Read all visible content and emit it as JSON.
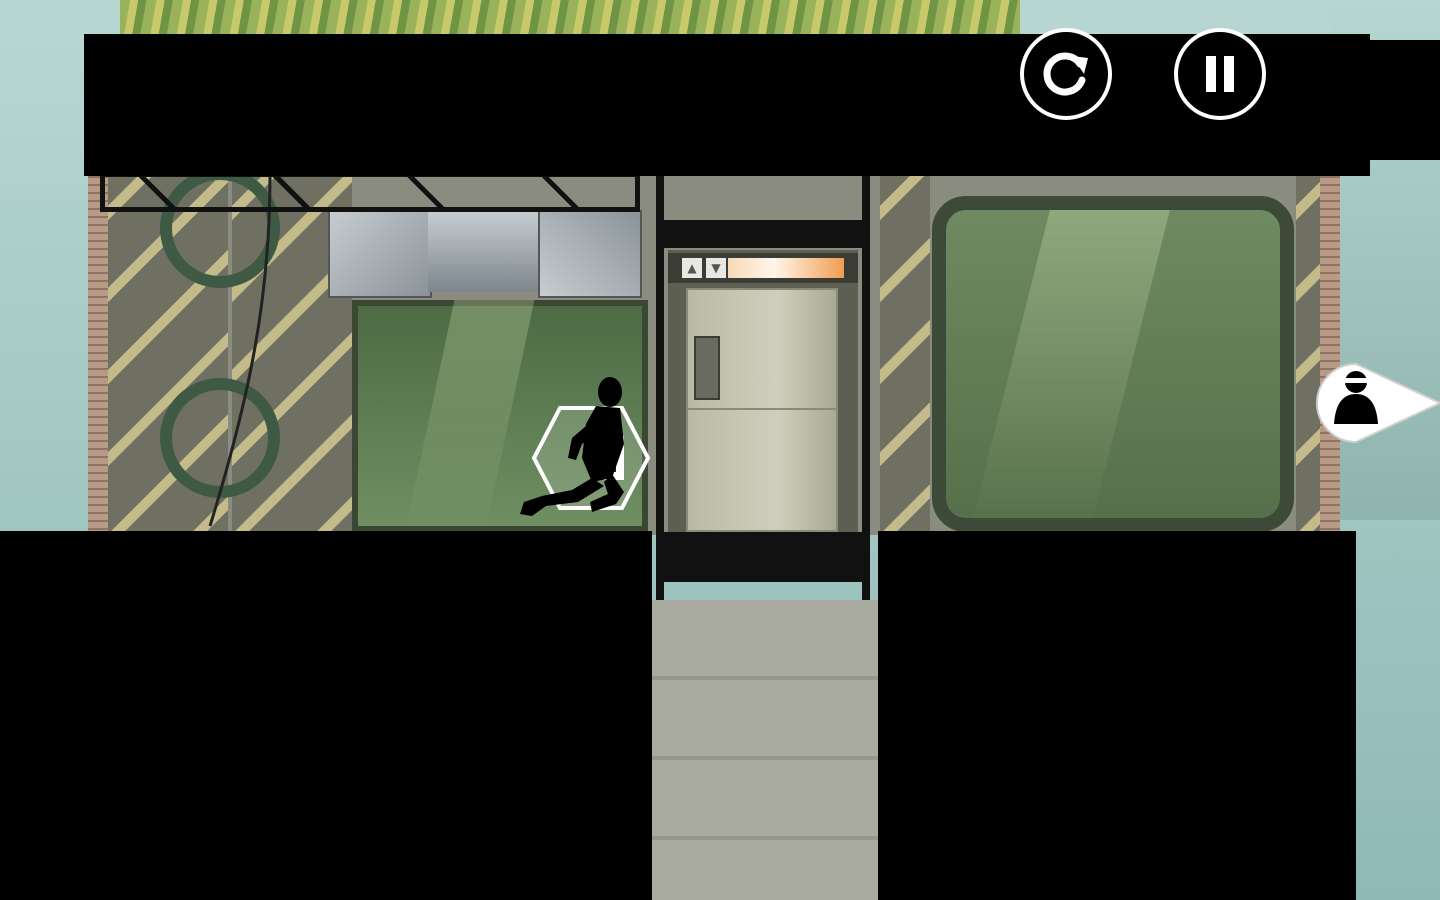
{
  "game": {
    "scene": "elevator-corridor",
    "controls": {
      "restart_icon": "restart-icon",
      "pause_icon": "pause-icon"
    },
    "offscreen_marker": {
      "icon": "guard-head-icon",
      "direction": "right"
    },
    "elevator": {
      "indicator_icons": [
        "elevator-up-icon",
        "elevator-down-icon"
      ],
      "indicator_up": "▲",
      "indicator_down": "▼"
    },
    "colors": {
      "silhouette": "#000000",
      "button_outline": "#ffffff",
      "elevator_bar": "#f19d52",
      "window_green": "#6f8a62",
      "hazard_stripe": "#c9c08a"
    }
  }
}
